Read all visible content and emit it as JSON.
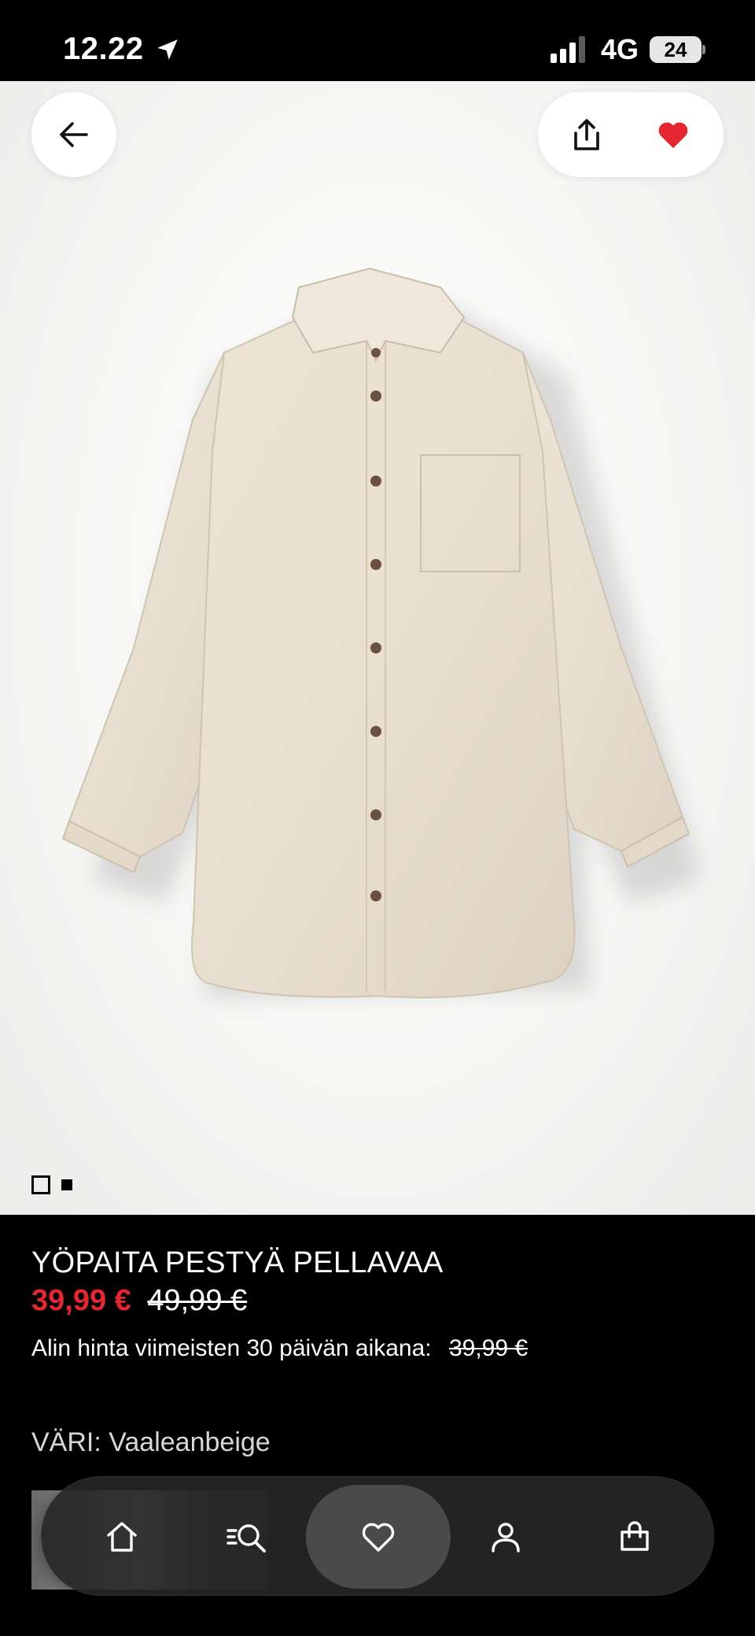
{
  "status_bar": {
    "time": "12.22",
    "network": "4G",
    "battery": "24"
  },
  "gallery": {
    "active_index": 0,
    "count": 2
  },
  "product": {
    "title": "YÖPAITA PESTYÄ PELLAVAA",
    "sale_price": "39,99 €",
    "original_price": "49,99 €",
    "lowest_price_label": "Alin hinta viimeisten 30 päivän aikana:",
    "lowest_price": "39,99 €",
    "color_label": "VÄRI: Vaaleanbeige"
  },
  "colors": {
    "sale": "#e3262f",
    "favorite_heart": "#e3262f",
    "background": "#000000"
  },
  "icons": {
    "back": "arrow-left-icon",
    "share": "share-icon",
    "favorite": "heart-icon",
    "nav": [
      "home-icon",
      "search-icon",
      "heart-icon",
      "account-icon",
      "bag-icon"
    ]
  },
  "bottom_nav": {
    "active": "favorites"
  }
}
